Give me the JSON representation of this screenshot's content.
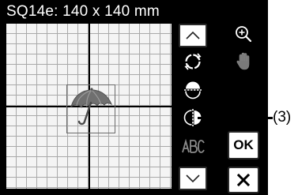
{
  "hoop": {
    "title": "SQ14e: 140 x 140 mm"
  },
  "buttons": {
    "ok_label": "OK"
  },
  "icons": {
    "up": "chevron-up-icon",
    "zoom": "zoom-in-icon",
    "rotate": "rotate-icon",
    "hand": "hand-icon",
    "flip_vertical": "flip-vertical-icon",
    "flip_horizontal": "flip-horizontal-icon",
    "abc": "abc-text-icon",
    "down": "chevron-down-icon",
    "close": "close-icon"
  },
  "callout": {
    "label": "(3)"
  },
  "colors": {
    "screen_bg": "#000000",
    "grid_bg": "#f4f4f4",
    "grid_line": "#a9a9a9",
    "disabled_icon": "#8a8a8a"
  }
}
